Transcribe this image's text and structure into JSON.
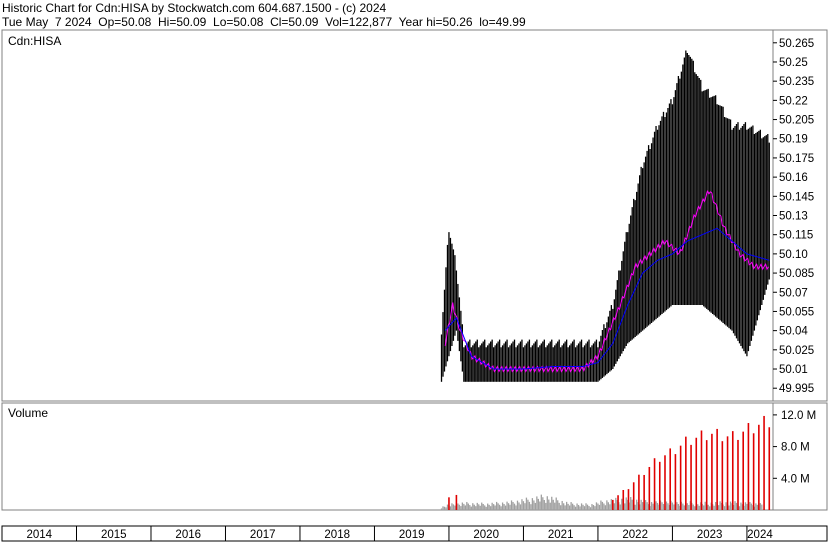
{
  "header": {
    "line1": "Historic Chart for Cdn:HISA by Stockwatch.com 604.687.1500 - (c) 2024",
    "line2": "Tue May  7 2024  Op=50.08  Hi=50.09  Lo=50.08  Cl=50.09  Vol=122,877  Year hi=50.26  lo=49.99"
  },
  "chart_data": {
    "type": "bar",
    "title": "Historic Chart for Cdn:HISA",
    "price_panel": {
      "label": "Cdn:HISA",
      "ylim": [
        49.985,
        50.275
      ],
      "yticks": [
        "50.265",
        "50.25",
        "50.235",
        "50.22",
        "50.205",
        "50.19",
        "50.175",
        "50.16",
        "50.145",
        "50.13",
        "50.115",
        "50.10",
        "50.085",
        "50.07",
        "50.055",
        "50.04",
        "50.025",
        "50.01",
        "49.995"
      ],
      "ohlc_note": "weekly high-low bars",
      "series": [
        {
          "name": "high-low",
          "x": [
            2019.9,
            2020.0,
            2020.1,
            2020.2,
            2020.5,
            2021.0,
            2021.5,
            2022.0,
            2022.2,
            2022.4,
            2022.6,
            2022.8,
            2023.0,
            2023.2,
            2023.4,
            2023.6,
            2023.8,
            2024.0,
            2024.3
          ],
          "high": [
            50.04,
            50.12,
            50.09,
            50.03,
            50.03,
            50.03,
            50.03,
            50.03,
            50.06,
            50.12,
            50.17,
            50.2,
            50.22,
            50.26,
            50.23,
            50.22,
            50.2,
            50.2,
            50.19
          ],
          "low": [
            50.0,
            50.02,
            50.04,
            50.0,
            50.0,
            50.0,
            50.0,
            50.0,
            50.01,
            50.03,
            50.04,
            50.05,
            50.06,
            50.06,
            50.06,
            50.05,
            50.04,
            50.02,
            50.08
          ]
        },
        {
          "name": "close",
          "x": [
            2019.95,
            2020.05,
            2020.15,
            2020.3,
            2020.6,
            2021.0,
            2021.4,
            2021.8,
            2022.0,
            2022.15,
            2022.3,
            2022.5,
            2022.7,
            2022.9,
            2023.1,
            2023.3,
            2023.5,
            2023.7,
            2023.9,
            2024.1,
            2024.3
          ],
          "values": [
            50.03,
            50.06,
            50.04,
            50.02,
            50.01,
            50.01,
            50.01,
            50.01,
            50.02,
            50.04,
            50.06,
            50.09,
            50.1,
            50.11,
            50.1,
            50.13,
            50.15,
            50.12,
            50.1,
            50.09,
            50.09
          ]
        },
        {
          "name": "moving-average",
          "x": [
            2019.95,
            2020.1,
            2020.3,
            2020.6,
            2021.0,
            2021.4,
            2021.8,
            2022.0,
            2022.2,
            2022.4,
            2022.6,
            2022.8,
            2023.0,
            2023.2,
            2023.4,
            2023.6,
            2023.8,
            2024.0,
            2024.3
          ],
          "values": [
            50.04,
            50.05,
            50.02,
            50.01,
            50.01,
            50.012,
            50.012,
            50.015,
            50.03,
            50.06,
            50.085,
            50.095,
            50.1,
            50.11,
            50.115,
            50.12,
            50.11,
            50.1,
            50.095
          ]
        }
      ]
    },
    "volume_panel": {
      "label": "Volume",
      "ylim": [
        0,
        13500000
      ],
      "yticks": [
        {
          "label": "12.0 M",
          "v": 12000000
        },
        {
          "label": "8.0 M",
          "v": 8000000
        },
        {
          "label": "4.0 M",
          "v": 4000000
        }
      ],
      "gray_samples": [
        [
          2019.9,
          400000
        ],
        [
          2020.0,
          700000
        ],
        [
          2020.2,
          900000
        ],
        [
          2020.5,
          800000
        ],
        [
          2020.8,
          1000000
        ],
        [
          2021.0,
          1300000
        ],
        [
          2021.3,
          1800000
        ],
        [
          2021.6,
          900000
        ],
        [
          2021.9,
          700000
        ],
        [
          2022.1,
          1200000
        ],
        [
          2022.4,
          1500000
        ],
        [
          2022.7,
          1000000
        ],
        [
          2023.0,
          1100000
        ],
        [
          2023.4,
          900000
        ],
        [
          2023.8,
          1000000
        ],
        [
          2024.2,
          800000
        ]
      ],
      "red_samples": [
        [
          2020.0,
          1600000
        ],
        [
          2020.1,
          1900000
        ],
        [
          2022.2,
          1500000
        ],
        [
          2022.4,
          3000000
        ],
        [
          2022.6,
          5000000
        ],
        [
          2022.8,
          7000000
        ],
        [
          2023.0,
          8000000
        ],
        [
          2023.2,
          9500000
        ],
        [
          2023.5,
          10500000
        ],
        [
          2023.8,
          10000000
        ],
        [
          2024.0,
          11000000
        ],
        [
          2024.35,
          12500000
        ]
      ]
    },
    "x_axis": {
      "ylabel": "",
      "xlim": [
        2014.0,
        2024.35
      ],
      "years": [
        "2014",
        "2015",
        "2016",
        "2017",
        "2018",
        "2019",
        "2020",
        "2021",
        "2022",
        "2023",
        "2024"
      ]
    },
    "colors": {
      "hl_bar": "#000000",
      "close": "#ff00ff",
      "ma": "#0000ff",
      "vol_gray": "#a0a0a0",
      "vol_red": "#e00000",
      "panel_bg": "#ffffff",
      "frame": "#808080"
    }
  }
}
